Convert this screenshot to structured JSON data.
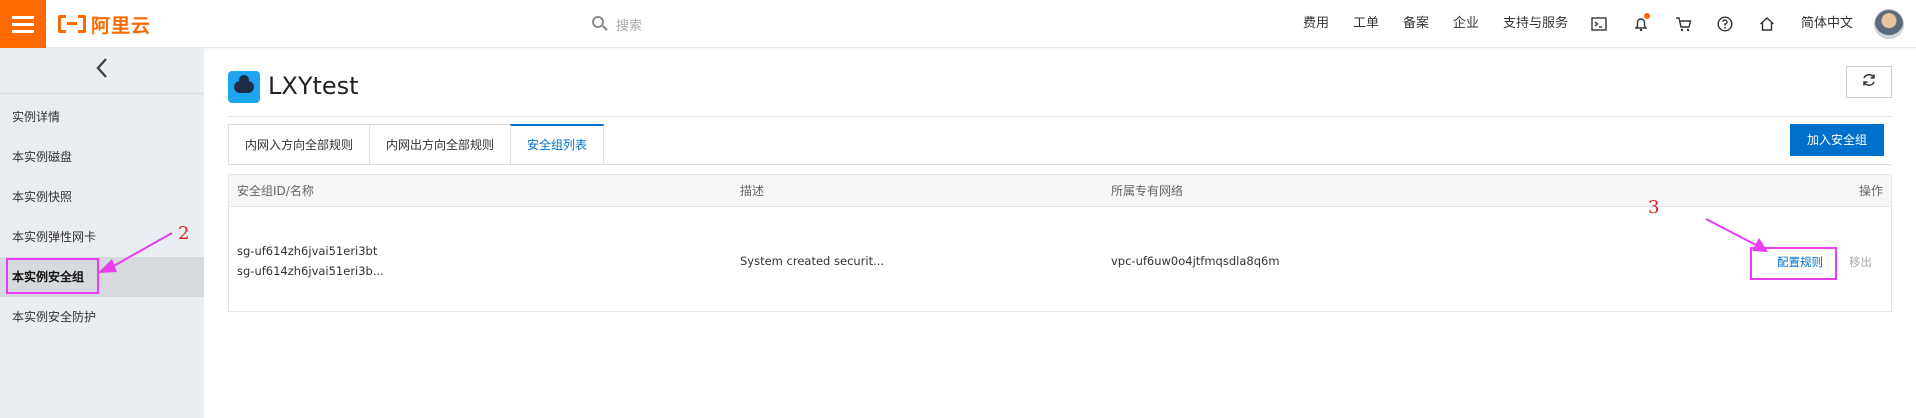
{
  "topbar": {
    "logo_text": "阿里云",
    "search_placeholder": "搜索",
    "nav": [
      "费用",
      "工单",
      "备案",
      "企业",
      "支持与服务"
    ],
    "language": "简体中文",
    "icons": [
      "terminal-icon",
      "bell-icon",
      "cart-icon",
      "help-icon",
      "home-icon"
    ],
    "accent": "#ff6a00"
  },
  "sidebar": {
    "items": [
      {
        "label": "实例详情"
      },
      {
        "label": "本实例磁盘"
      },
      {
        "label": "本实例快照"
      },
      {
        "label": "本实例弹性网卡"
      },
      {
        "label": "本实例安全组",
        "active": true
      },
      {
        "label": "本实例安全防护"
      }
    ]
  },
  "header": {
    "title": "LXYtest",
    "refresh_icon": "refresh-icon"
  },
  "tabs": [
    {
      "label": "内网入方向全部规则"
    },
    {
      "label": "内网出方向全部规则"
    },
    {
      "label": "安全组列表",
      "active": true
    }
  ],
  "toolbar": {
    "add_label": "加入安全组"
  },
  "table": {
    "columns": [
      "安全组ID/名称",
      "描述",
      "所属专有网络",
      "操作"
    ],
    "rows": [
      {
        "id": "sg-uf614zh6jvai51eri3bt",
        "name": "sg-uf614zh6jvai51eri3b...",
        "description": "System created securit...",
        "vpc": "vpc-uf6uw0o4jtfmqsdla8q6m",
        "action_configure": "配置规则",
        "action_remove": "移出"
      }
    ]
  },
  "annotations": {
    "step2": "2",
    "step3": "3",
    "color": "#e63ef0"
  }
}
